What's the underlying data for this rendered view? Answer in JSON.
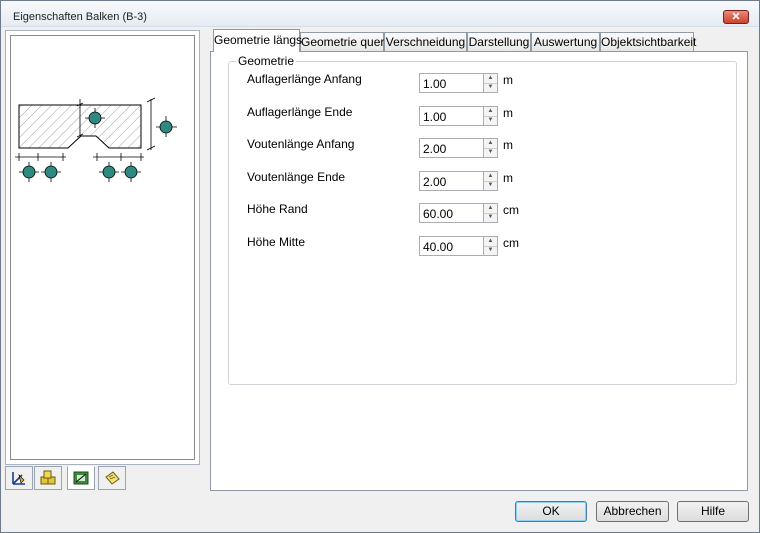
{
  "window": {
    "title": "Eigenschaften Balken (B-3)",
    "close_glyph": "✕"
  },
  "left_tabs": [
    {
      "icon": "geometry-tool-icon"
    },
    {
      "icon": "materials-icon"
    },
    {
      "icon": "reinforcement-icon"
    },
    {
      "icon": "notes-icon"
    }
  ],
  "tabs": [
    {
      "label": "Geometrie längs"
    },
    {
      "label": "Geometrie quer"
    },
    {
      "label": "Verschneidung"
    },
    {
      "label": "Darstellung"
    },
    {
      "label": "Auswertung"
    },
    {
      "label": "Objektsichtbarkeit"
    }
  ],
  "group": {
    "title": "Geometrie",
    "fields": [
      {
        "label": "Auflagerlänge Anfang",
        "value": "1.00",
        "unit": "m"
      },
      {
        "label": "Auflagerlänge Ende",
        "value": "1.00",
        "unit": "m"
      },
      {
        "label": "Voutenlänge Anfang",
        "value": "2.00",
        "unit": "m"
      },
      {
        "label": "Voutenlänge Ende",
        "value": "2.00",
        "unit": "m"
      },
      {
        "label": "Höhe Rand",
        "value": "60.00",
        "unit": "cm"
      },
      {
        "label": "Höhe Mitte",
        "value": "40.00",
        "unit": "cm"
      }
    ]
  },
  "buttons": {
    "ok": "OK",
    "cancel": "Abbrechen",
    "help": "Hilfe"
  },
  "colors": {
    "marker_fill": "#2e8a80",
    "hatch": "#777777"
  }
}
